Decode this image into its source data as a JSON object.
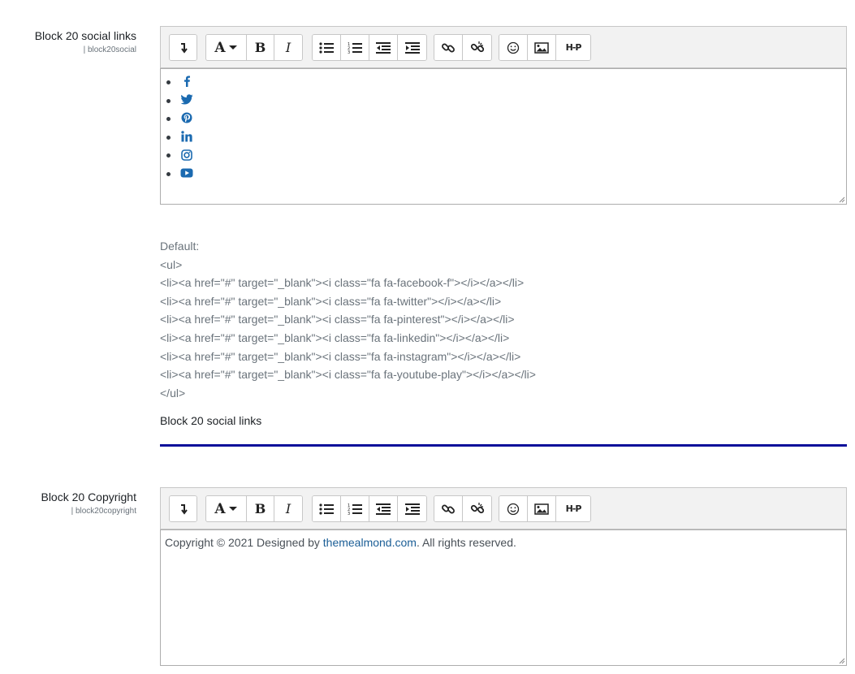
{
  "settings": [
    {
      "label": "Block 20 social links",
      "key": "| block20social",
      "social_icons": [
        "facebook-icon",
        "twitter-icon",
        "pinterest-icon",
        "linkedin-icon",
        "instagram-icon",
        "youtube-icon"
      ]
    },
    {
      "label": "Block 20 Copyright",
      "key": "| block20copyright",
      "content": {
        "prefix": "Copyright © 2021 Designed by ",
        "link_text": "themealmond.com",
        "suffix": ". All rights reserved."
      }
    }
  ],
  "default_block": {
    "heading": "Default:",
    "lines": [
      "<ul>",
      "<li><a href=\"#\" target=\"_blank\"><i class=\"fa fa-facebook-f\"></i></a></li>",
      "<li><a href=\"#\" target=\"_blank\"><i class=\"fa fa-twitter\"></i></a></li>",
      "<li><a href=\"#\" target=\"_blank\"><i class=\"fa fa-pinterest\"></i></a></li>",
      "<li><a href=\"#\" target=\"_blank\"><i class=\"fa fa-linkedin\"></i></a></li>",
      "<li><a href=\"#\" target=\"_blank\"><i class=\"fa fa-instagram\"></i></a></li>",
      "<li><a href=\"#\" target=\"_blank\"><i class=\"fa fa-youtube-play\"></i></a></li>",
      "</ul>"
    ]
  },
  "description": "Block 20 social links",
  "toolbar": {
    "font_glyph": "A",
    "bold_glyph": "B",
    "italic_glyph": "I",
    "h5p_glyph": "H-P"
  },
  "colors": {
    "icon_blue": "#1b6ab0",
    "link_blue": "#1b5e96",
    "divider": "#0a0e9a"
  }
}
